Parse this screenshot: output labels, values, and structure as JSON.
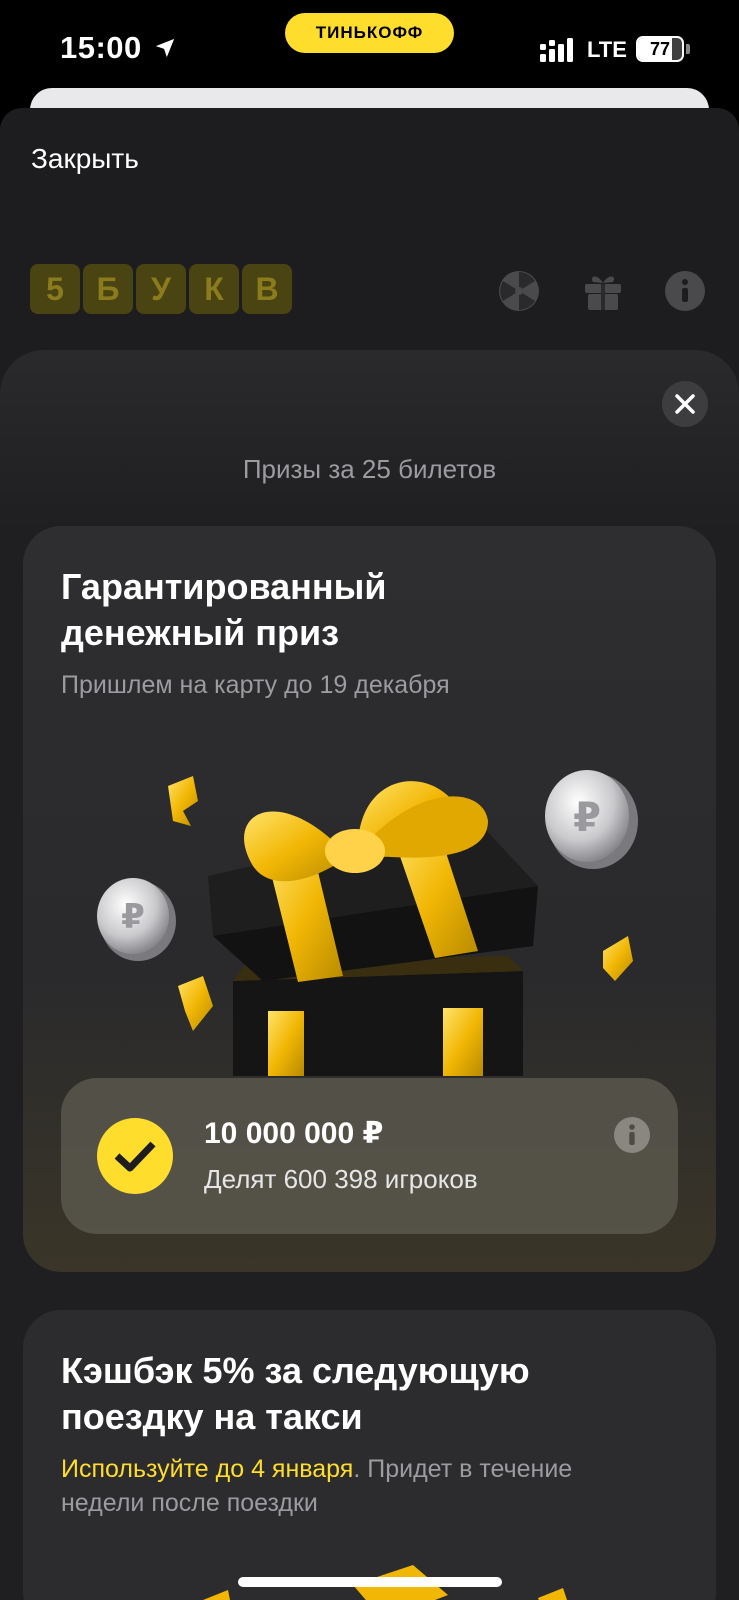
{
  "status_bar": {
    "time": "15:00",
    "bank_badge": "ТИНЬКОФФ",
    "network": "LTE",
    "battery_level": "77",
    "battery_percent": 77
  },
  "header": {
    "close_label": "Закрыть",
    "game_logo_letters": [
      "5",
      "Б",
      "У",
      "К",
      "В"
    ],
    "icons": [
      "wheel-icon",
      "gift-icon",
      "info-icon"
    ]
  },
  "modal": {
    "title": "Призы за 25 билетов",
    "cards": [
      {
        "title_line1": "Гарантированный",
        "title_line2": "денежный приз",
        "subtitle": "Пришлем на карту до 19 декабря",
        "prize_amount": "10 000 000 ₽",
        "prize_share": "Делят 600 398 игроков"
      },
      {
        "title_line1": "Кэшбэк 5% за следующую",
        "title_line2": "поездку на такси",
        "subtitle_highlight": "Используйте до 4 января",
        "subtitle_rest": ". Придет в течение",
        "subtitle_line2": "недели после поездки"
      }
    ]
  },
  "colors": {
    "accent": "#ffdd2d",
    "background": "#1d1d1f",
    "card": "#2c2c2e",
    "muted_text": "#9b9ba0"
  }
}
